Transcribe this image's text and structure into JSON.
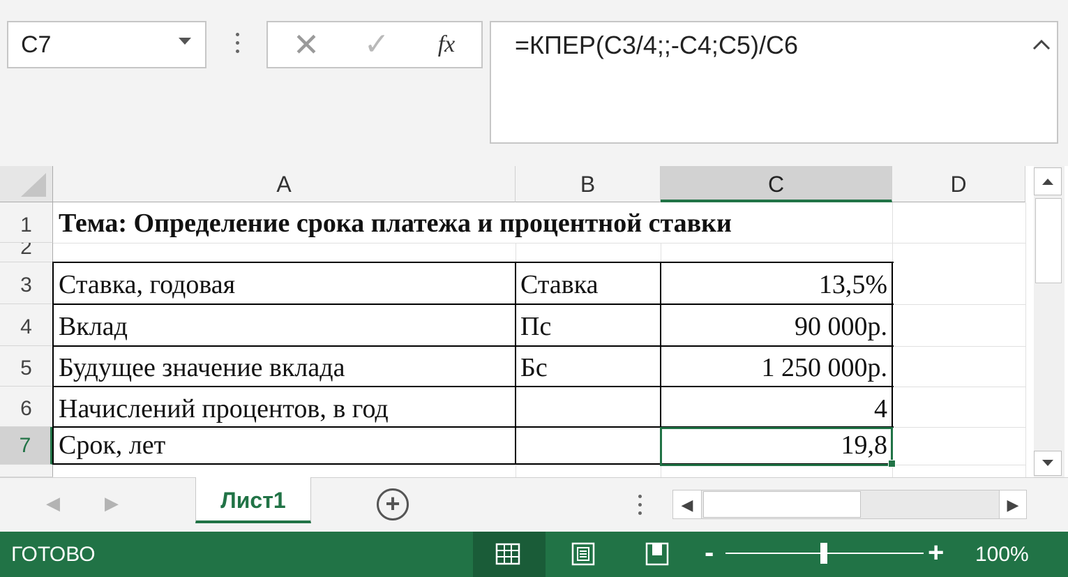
{
  "formula_bar": {
    "name_box": "C7",
    "fx_label": "fx",
    "formula": "=КПЕР(C3/4;;-C4;C5)/C6"
  },
  "columns": [
    "A",
    "B",
    "C",
    "D"
  ],
  "rows": [
    "1",
    "2",
    "3",
    "4",
    "5",
    "6",
    "7"
  ],
  "selected_cell": "C7",
  "cells": {
    "a1": "Тема: Определение срока платежа и процентной ставки",
    "a3": "Ставка, годовая",
    "b3": "Ставка",
    "c3": "13,5%",
    "a4": "Вклад",
    "b4": "Пс",
    "c4": "90 000р.",
    "a5": "Будущее значение вклада",
    "b5": "Бс",
    "c5": "1 250 000р.",
    "a6": "Начислений процентов, в год",
    "c6": "4",
    "a7": "Срок, лет",
    "c7": "19,8"
  },
  "sheet_tabs": {
    "active": "Лист1",
    "add_icon": "plus-circle-icon"
  },
  "status_bar": {
    "status": "ГОТОВО",
    "zoom": "100%",
    "zoom_minus": "-",
    "zoom_plus": "+"
  },
  "colors": {
    "accent": "#217346",
    "status_bar_bg": "#217346"
  }
}
